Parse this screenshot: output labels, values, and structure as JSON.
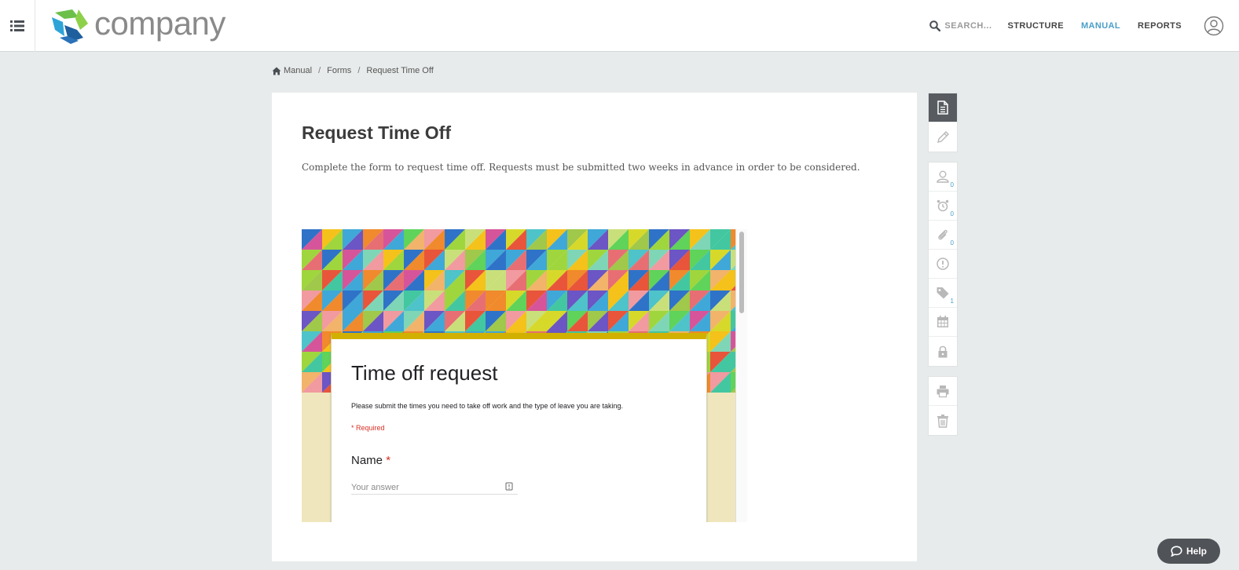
{
  "header": {
    "logo_text": "company",
    "search_label": "SEARCH...",
    "nav": [
      {
        "label": "STRUCTURE"
      },
      {
        "label": "MANUAL"
      },
      {
        "label": "REPORTS"
      }
    ]
  },
  "breadcrumb": {
    "items": [
      "Manual",
      "Forms",
      "Request Time Off"
    ],
    "separator": "/"
  },
  "page": {
    "title": "Request Time Off",
    "description": "Complete the form to request time off. Requests must be submitted two weeks in advance in order to be considered."
  },
  "embedded_form": {
    "title": "Time off request",
    "description": "Please submit the times you need to take off work and the type of leave you are taking.",
    "required_note": "* Required",
    "question": {
      "label": "Name",
      "required_mark": "*",
      "placeholder": "Your answer"
    }
  },
  "toolbar": {
    "counts": {
      "owners": "0",
      "reminders": "0",
      "attachments": "0",
      "tags": "1"
    }
  },
  "help": {
    "label": "Help"
  },
  "colors": {
    "accent": "#4a9fc8",
    "background": "#e8ebeb",
    "rail_active": "#585c61",
    "form_accent": "#d2b000",
    "required_red": "#d93025"
  }
}
